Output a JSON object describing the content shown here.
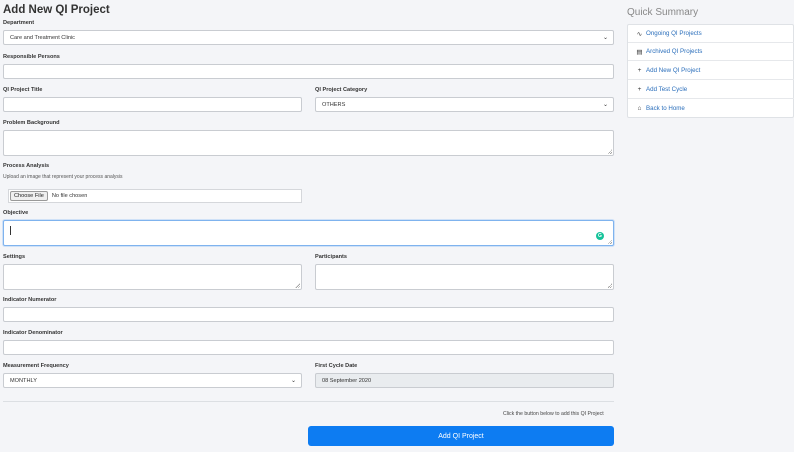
{
  "form": {
    "title": "Add New QI Project",
    "department": {
      "label": "Department",
      "value": "Care and Treatment Clinic"
    },
    "responsible": {
      "label": "Responsible Persons",
      "value": ""
    },
    "project_title": {
      "label": "QI Project Title",
      "value": ""
    },
    "category": {
      "label": "QI Project Category",
      "value": "OTHERS"
    },
    "problem": {
      "label": "Problem Background"
    },
    "process": {
      "label": "Process Analysis",
      "hint": "Upload an image that represent your process analysis",
      "button": "Choose File",
      "status": "No file chosen"
    },
    "objective": {
      "label": "Objective"
    },
    "settings": {
      "label": "Settings"
    },
    "participants": {
      "label": "Participants"
    },
    "numerator": {
      "label": "Indicator Numerator",
      "value": ""
    },
    "denominator": {
      "label": "Indicator Denominator",
      "value": ""
    },
    "frequency": {
      "label": "Measurement Frequency",
      "value": "MONTHLY"
    },
    "first_cycle": {
      "label": "First Cycle Date",
      "value": "08 September 2020"
    },
    "submit_note": "Click the button below to add this QI Project",
    "submit_label": "Add QI Project"
  },
  "sidebar": {
    "title": "Quick Summary",
    "items": [
      {
        "label": "Ongoing QI Projects",
        "icon": "activity-icon"
      },
      {
        "label": "Archived QI Projects",
        "icon": "archive-icon"
      },
      {
        "label": "Add New QI Project",
        "icon": "plus-icon"
      },
      {
        "label": "Add Test Cycle",
        "icon": "plus-icon"
      },
      {
        "label": "Back to Home",
        "icon": "home-icon"
      }
    ]
  },
  "colors": {
    "primary": "#0d7cf2",
    "link": "#2a6ebb",
    "background": "#f4f5f8"
  }
}
